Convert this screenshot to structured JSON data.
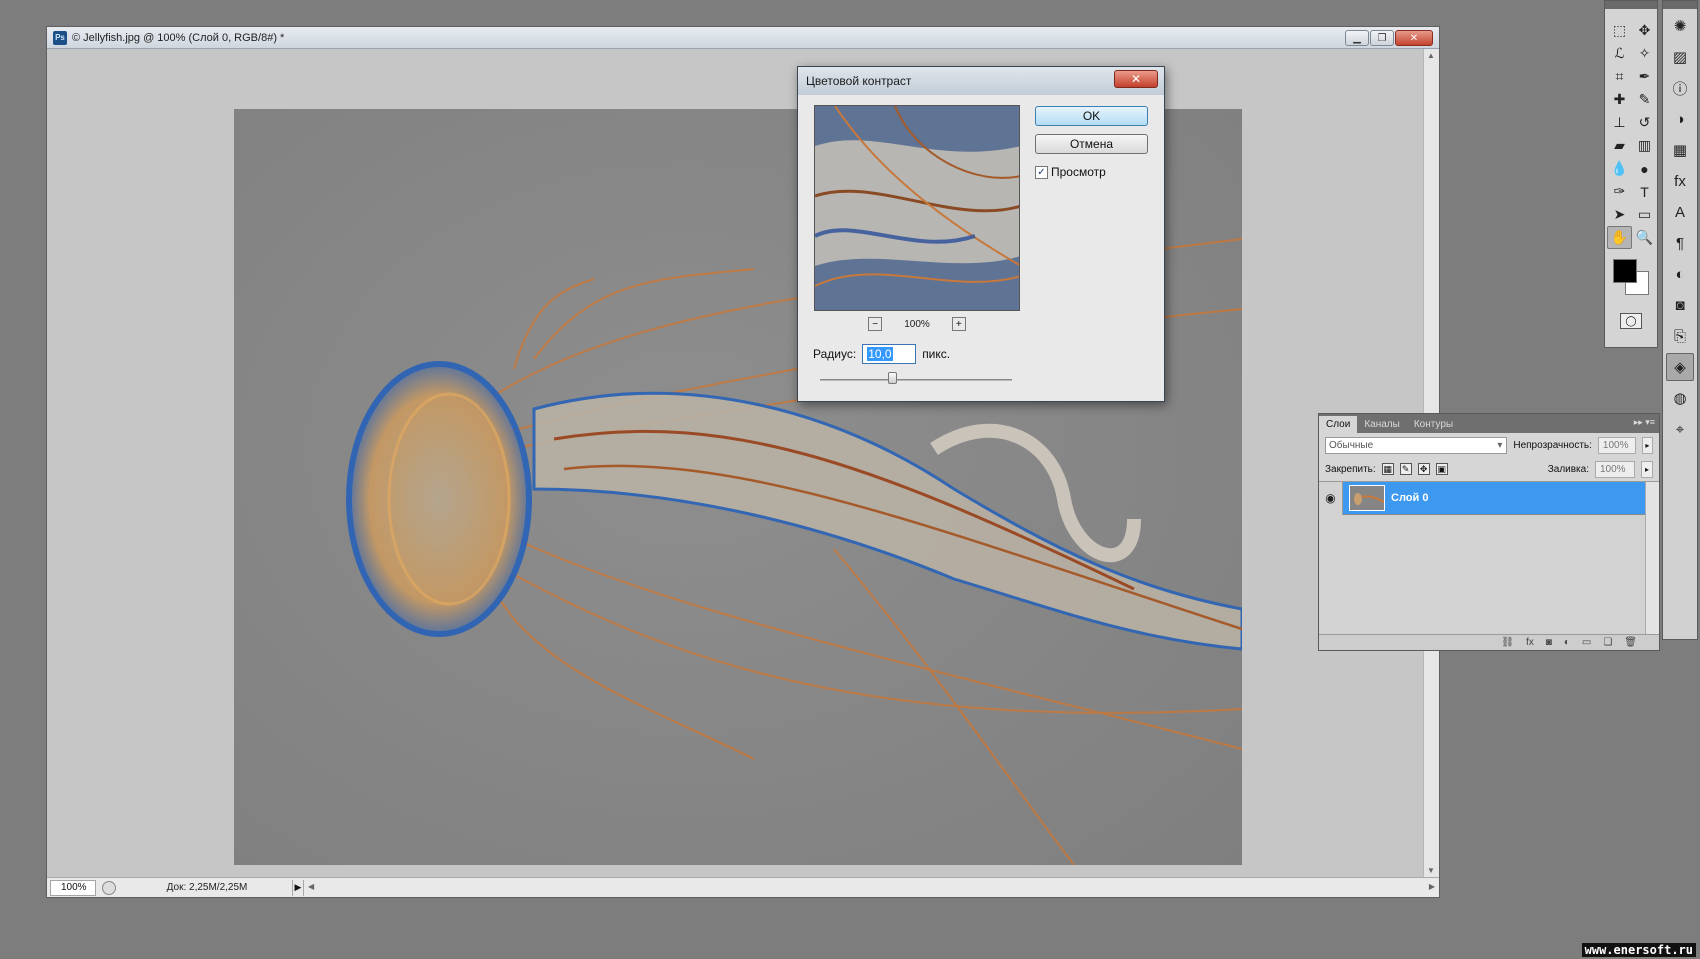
{
  "document": {
    "app_badge": "Ps",
    "title": "© Jellyfish.jpg @ 100% (Слой 0, RGB/8#) *",
    "zoom": "100%",
    "doc_info": "Док: 2,25M/2,25M"
  },
  "dialog": {
    "title": "Цветовой контраст",
    "ok_label": "OK",
    "cancel_label": "Отмена",
    "preview_label": "Просмотр",
    "preview_checked": true,
    "preview_zoom": "100%",
    "radius_label": "Радиус:",
    "radius_value": "10,0",
    "radius_unit": "пикс.",
    "radius_slider_fraction": 0.38
  },
  "layers_panel": {
    "tabs": [
      "Слои",
      "Каналы",
      "Контуры"
    ],
    "blend_mode": "Обычные",
    "opacity_label": "Непрозрачность:",
    "opacity_value": "100%",
    "lock_label": "Закрепить:",
    "fill_label": "Заливка:",
    "fill_value": "100%",
    "layer_name": "Слой 0",
    "footer_icons": [
      "link-icon",
      "fx-icon",
      "mask-icon",
      "adjustment-icon",
      "group-icon",
      "new-layer-icon",
      "trash-icon"
    ]
  },
  "tools": {
    "foreground_color": "#000000",
    "background_color": "#ffffff"
  },
  "colors": {
    "accent": "#3d98f0",
    "jelly_orange": "#c8783a",
    "jelly_blue": "#2a63b8"
  },
  "watermark": "www.enersoft.ru"
}
